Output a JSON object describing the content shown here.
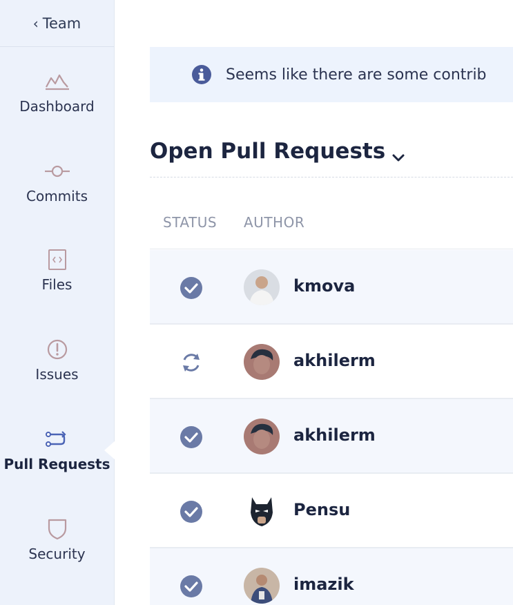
{
  "sidebar": {
    "back_label": "Team",
    "items": [
      {
        "label": "Dashboard",
        "icon": "dashboard-icon"
      },
      {
        "label": "Commits",
        "icon": "commit-icon"
      },
      {
        "label": "Files",
        "icon": "file-code-icon"
      },
      {
        "label": "Issues",
        "icon": "issue-icon"
      },
      {
        "label": "Pull Requests",
        "icon": "pull-request-icon",
        "active": true
      },
      {
        "label": "Security",
        "icon": "shield-icon"
      }
    ]
  },
  "banner": {
    "text": "Seems like there are some contrib",
    "icon": "info-icon"
  },
  "section": {
    "title": "Open Pull Requests"
  },
  "table": {
    "columns": [
      "STATUS",
      "AUTHOR"
    ],
    "rows": [
      {
        "status": "approved",
        "author": "kmova"
      },
      {
        "status": "in-progress",
        "author": "akhilerm"
      },
      {
        "status": "approved",
        "author": "akhilerm"
      },
      {
        "status": "approved",
        "author": "Pensu"
      },
      {
        "status": "approved",
        "author": "imazik"
      }
    ]
  },
  "colors": {
    "sidebar_bg": "#edf2fb",
    "banner_bg": "#edf3fd",
    "status_icon": "#6a7aa6",
    "text_dark": "#1c2540",
    "text_muted": "#8e95a8"
  }
}
